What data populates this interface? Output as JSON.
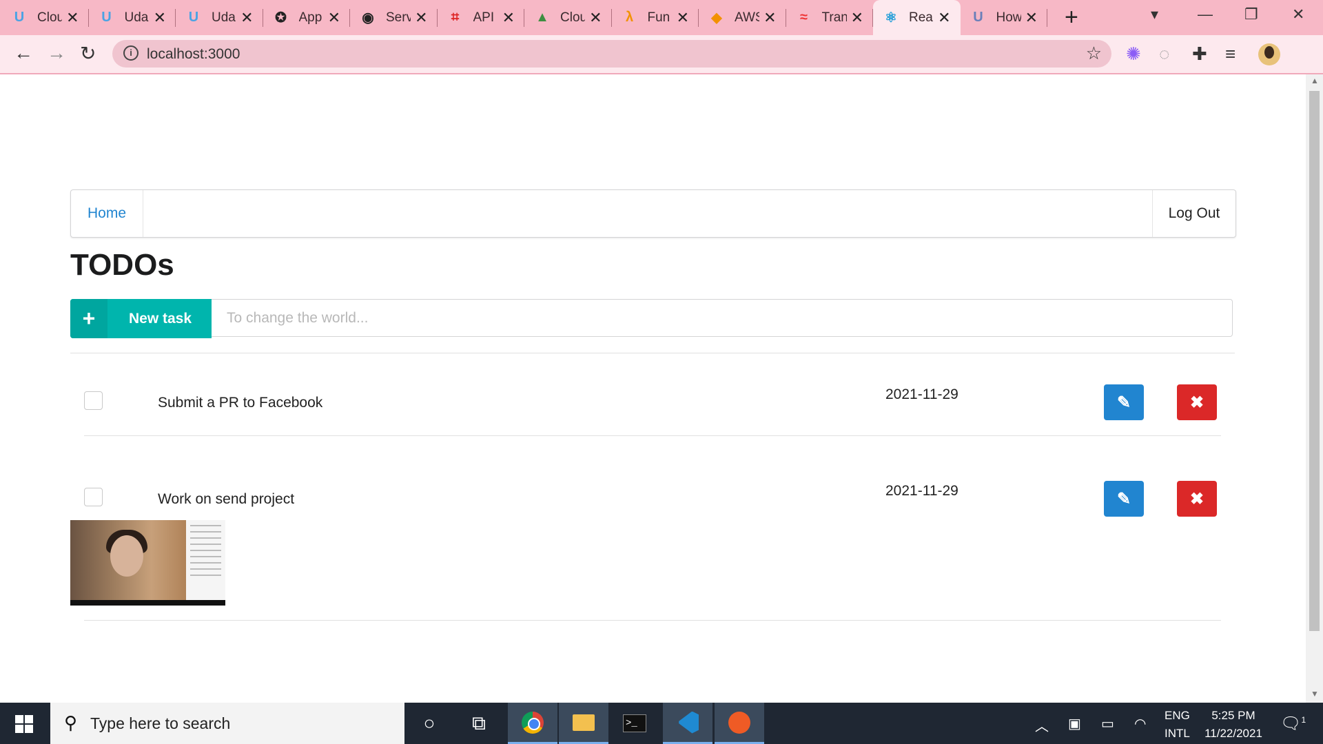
{
  "browser": {
    "tabs": [
      {
        "icon": "udacity-icon",
        "glyph": "U",
        "color": "#4aa3e4",
        "title": "Clou"
      },
      {
        "icon": "udacity-icon",
        "glyph": "U",
        "color": "#4aa3e4",
        "title": "Uda"
      },
      {
        "icon": "udacity-icon",
        "glyph": "U",
        "color": "#4aa3e4",
        "title": "Uda"
      },
      {
        "icon": "app-icon",
        "glyph": "✪",
        "color": "#222",
        "title": "App"
      },
      {
        "icon": "github-icon",
        "glyph": "◉",
        "color": "#222",
        "title": "Serv"
      },
      {
        "icon": "api-icon",
        "glyph": "⌗",
        "color": "#d22",
        "title": "API"
      },
      {
        "icon": "cloud-icon",
        "glyph": "▲",
        "color": "#3e8e41",
        "title": "Clou"
      },
      {
        "icon": "lambda-icon",
        "glyph": "λ",
        "color": "#f29100",
        "title": "Fun"
      },
      {
        "icon": "aws-box-icon",
        "glyph": "◆",
        "color": "#f29100",
        "title": "AWS"
      },
      {
        "icon": "transfer-icon",
        "glyph": "≈",
        "color": "#e33",
        "title": "Tran"
      },
      {
        "icon": "react-icon",
        "glyph": "⚛",
        "color": "#1b9bd7",
        "title": "Rea",
        "active": true
      },
      {
        "icon": "udacity-icon",
        "glyph": "U",
        "color": "#6a7fb9",
        "title": "How"
      }
    ],
    "url": "localhost:3000"
  },
  "menu": {
    "home_label": "Home",
    "logout_label": "Log Out"
  },
  "page": {
    "title": "TODOs",
    "new_task_label": "New task",
    "input_placeholder": "To change the world..."
  },
  "todos": [
    {
      "name": "Submit a PR to Facebook",
      "due": "2021-11-29",
      "has_attachment": false
    },
    {
      "name": "Work on send project",
      "due": "2021-11-29",
      "has_attachment": true
    }
  ],
  "taskbar": {
    "search_placeholder": "Type here to search",
    "lang_top": "ENG",
    "lang_bottom": "INTL",
    "time": "5:25 PM",
    "date": "11/22/2021",
    "notification_count": "1"
  }
}
